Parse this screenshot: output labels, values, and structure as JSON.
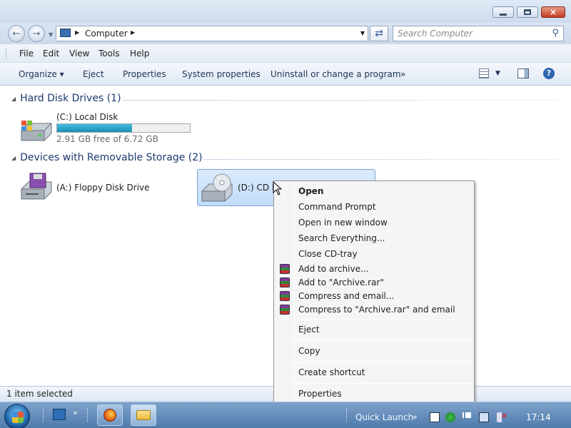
{
  "window": {
    "controls": {
      "minimize": "minimize-icon",
      "maximize": "maximize-icon",
      "close": "×"
    }
  },
  "address": {
    "location": "Computer",
    "search_placeholder": "Search Computer"
  },
  "menubar": {
    "items": [
      {
        "label": "File"
      },
      {
        "label": "Edit"
      },
      {
        "label": "View"
      },
      {
        "label": "Tools"
      },
      {
        "label": "Help"
      }
    ]
  },
  "commandbar": {
    "items": [
      {
        "label": "Organize ▾"
      },
      {
        "label": "Eject"
      },
      {
        "label": "Properties"
      },
      {
        "label": "System properties"
      },
      {
        "label": "Uninstall or change a program"
      },
      {
        "label": "»"
      }
    ]
  },
  "groups": {
    "hard_disks": {
      "title": "Hard Disk Drives (1)",
      "drives": [
        {
          "name": "(C:) Local Disk",
          "free_text": "2.91 GB free of 6.72 GB",
          "used_fraction": 0.567
        }
      ]
    },
    "removable": {
      "title": "Devices with Removable Storage (2)",
      "drives": [
        {
          "name": "(A:) Floppy Disk Drive"
        },
        {
          "name": "(D:) CD Drive"
        }
      ]
    }
  },
  "context_menu": {
    "items": [
      {
        "label": "Open",
        "bold": true
      },
      {
        "label": "Command Prompt"
      },
      {
        "label": "Open in new window"
      },
      {
        "label": "Search Everything..."
      },
      {
        "label": "Close CD-tray"
      },
      {
        "label": "Add to archive...",
        "icon": "winrar-icon"
      },
      {
        "label": "Add to \"Archive.rar\"",
        "icon": "winrar-icon"
      },
      {
        "label": "Compress and email...",
        "icon": "winrar-icon"
      },
      {
        "label": "Compress to \"Archive.rar\" and email",
        "icon": "winrar-icon"
      },
      {
        "label": "Eject"
      },
      {
        "label": "Copy"
      },
      {
        "label": "Create shortcut"
      },
      {
        "label": "Properties"
      }
    ]
  },
  "status": {
    "text": "1 item selected"
  },
  "taskbar": {
    "chevron": "»",
    "quick_launch": "Quick Launch",
    "clock": "17:14"
  }
}
